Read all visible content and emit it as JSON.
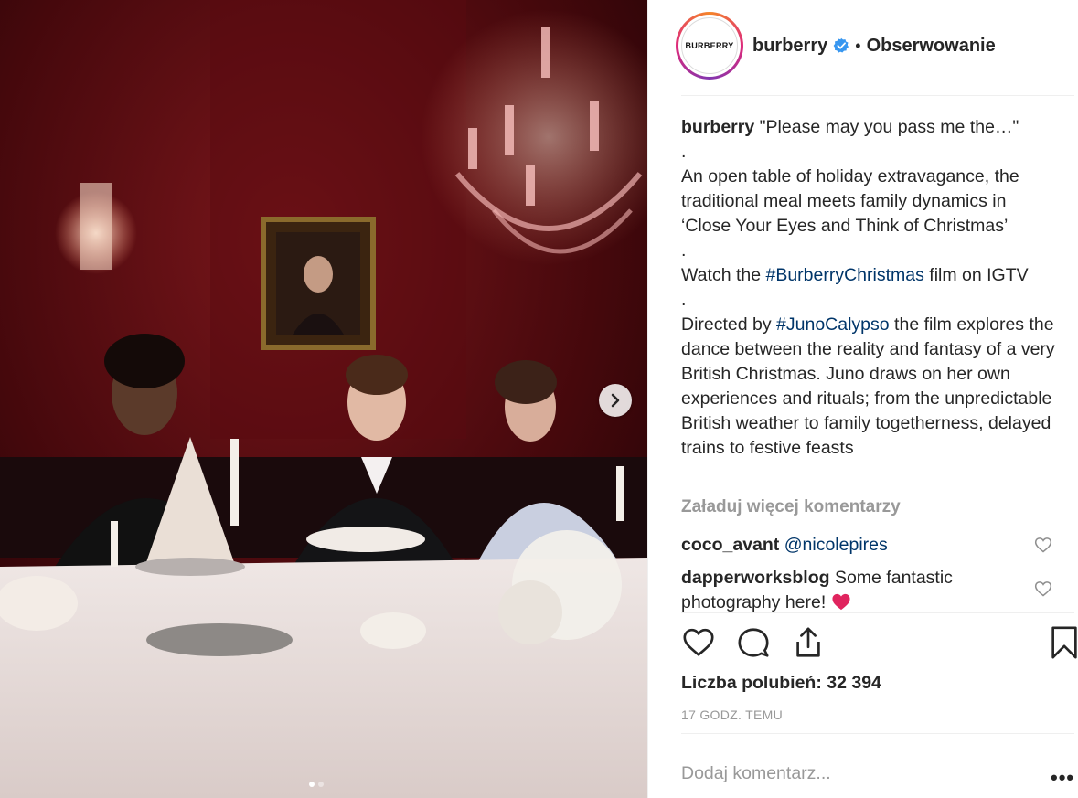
{
  "header": {
    "avatar_text": "BURBERRY",
    "username": "burberry",
    "bullet": "•",
    "follow_label": "Obserwowanie"
  },
  "caption": {
    "username": "burberry",
    "line1": "\"Please may you pass me the…\"",
    "sep1": ".",
    "para1": "An open table of holiday extravagance, the traditional meal meets family dynamics in ‘Close Your Eyes and Think of Christmas’",
    "sep2": ".",
    "watch_prefix": "Watch the ",
    "watch_tag": "#BurberryChristmas",
    "watch_suffix": " film on IGTV",
    "sep3": ".",
    "directed_prefix": "Directed by ",
    "directed_tag": "#JunoCalypso",
    "directed_suffix": " the film explores the dance between the reality and fantasy of a very British Christmas. Juno draws on her own experiences and rituals; from the unpredictable British weather to family togetherness, delayed trains to festive feasts"
  },
  "load_more_label": "Załaduj więcej komentarzy",
  "comments": [
    {
      "username": "coco_avant",
      "mention": "@nicolepires",
      "text": ""
    },
    {
      "username": "dapperworksblog",
      "mention": "",
      "text": "Some fantastic photography here!"
    }
  ],
  "likes_label": "Liczba polubień: 32 394",
  "timestamp": "17 GODZ. TEMU",
  "add_comment_placeholder": "Dodaj komentarz...",
  "more_label": "•••",
  "carousel": {
    "current": 1,
    "total": 2
  },
  "icons": {
    "verified": "verified-badge-icon",
    "like": "heart-outline-icon",
    "comment": "speech-bubble-icon",
    "share": "share-upload-icon",
    "save": "bookmark-icon",
    "next": "chevron-right-icon"
  },
  "colors": {
    "hashtag": "#003569",
    "muted": "#999999",
    "verified": "#3897f0",
    "heart_emoji": "#e0245e",
    "text": "#262626"
  }
}
